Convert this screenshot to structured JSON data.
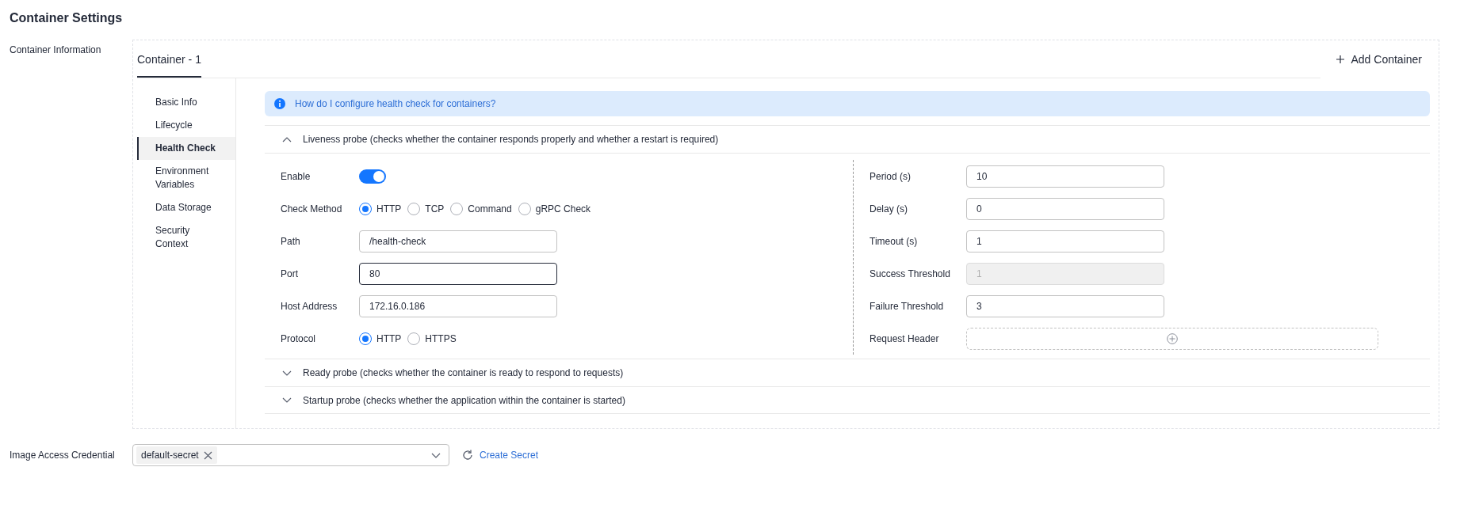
{
  "title": "Container Settings",
  "container_info": {
    "label": "Container Information",
    "tabs": [
      {
        "label": "Container - 1",
        "selected": true
      }
    ],
    "add_button": "Add Container",
    "side_nav": [
      {
        "label": "Basic Info",
        "selected": false
      },
      {
        "label": "Lifecycle",
        "selected": false
      },
      {
        "label": "Health Check",
        "selected": true
      },
      {
        "label": "Environment Variables",
        "selected": false
      },
      {
        "label": "Data Storage",
        "selected": false
      },
      {
        "label": "Security Context",
        "selected": false
      }
    ],
    "info_link": "How do I configure health check for containers?",
    "probes": [
      {
        "title": "Liveness probe (checks whether the container responds properly and whether a restart is required)",
        "expanded": true,
        "left_fields": [
          {
            "kind": "toggle",
            "label": "Enable",
            "on": true
          },
          {
            "kind": "radio",
            "label": "Check Method",
            "options": [
              {
                "label": "HTTP",
                "selected": true
              },
              {
                "label": "TCP",
                "selected": false
              },
              {
                "label": "Command",
                "selected": false
              },
              {
                "label": "gRPC Check",
                "selected": false
              }
            ]
          },
          {
            "kind": "input",
            "label": "Path",
            "value": "/health-check",
            "focused": false,
            "disabled": false
          },
          {
            "kind": "input",
            "label": "Port",
            "value": "80",
            "focused": true,
            "disabled": false
          },
          {
            "kind": "input",
            "label": "Host Address",
            "value": "172.16.0.186",
            "focused": false,
            "disabled": false
          },
          {
            "kind": "radio",
            "label": "Protocol",
            "options": [
              {
                "label": "HTTP",
                "selected": true
              },
              {
                "label": "HTTPS",
                "selected": false
              }
            ]
          }
        ],
        "right_fields": [
          {
            "kind": "input",
            "label": "Period (s)",
            "value": "10",
            "focused": false,
            "disabled": false
          },
          {
            "kind": "input",
            "label": "Delay (s)",
            "value": "0",
            "focused": false,
            "disabled": false
          },
          {
            "kind": "input",
            "label": "Timeout (s)",
            "value": "1",
            "focused": false,
            "disabled": false
          },
          {
            "kind": "input",
            "label": "Success Threshold",
            "value": "1",
            "focused": false,
            "disabled": true
          },
          {
            "kind": "input",
            "label": "Failure Threshold",
            "value": "3",
            "focused": false,
            "disabled": false
          },
          {
            "kind": "add",
            "label": "Request Header"
          }
        ]
      },
      {
        "title": "Ready probe (checks whether the container is ready to respond to requests)",
        "expanded": false
      },
      {
        "title": "Startup probe (checks whether the application within the container is started)",
        "expanded": false
      }
    ]
  },
  "image_access_credential": {
    "label": "Image Access Credential",
    "tags": [
      "default-secret"
    ],
    "link": "Create Secret"
  }
}
